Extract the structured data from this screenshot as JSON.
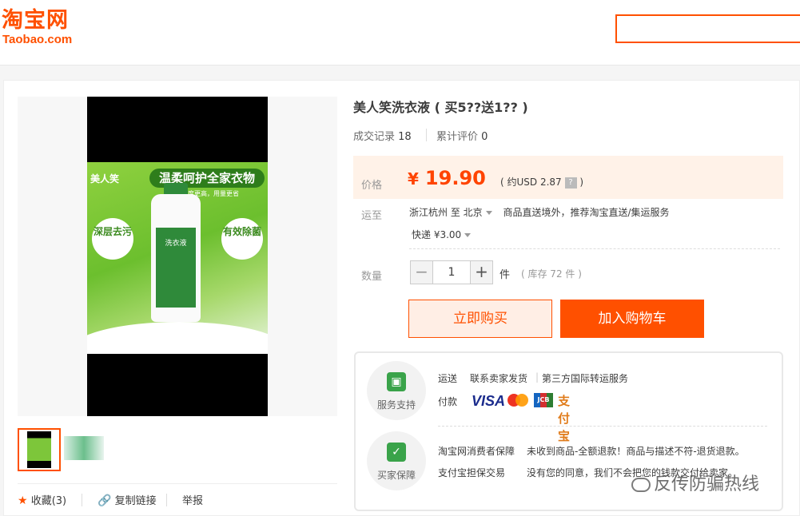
{
  "header": {
    "logo_cn": "淘宝网",
    "logo_en": "Taobao.com"
  },
  "gallery": {
    "image_texts": {
      "brand": "美人笑",
      "banner": "温柔呵护全家衣物",
      "sub": "浓度更高，用量更省",
      "bubble_left": "深层去污",
      "bubble_right": "有效除菌",
      "bottle_label": "洗衣液"
    },
    "actions": [
      {
        "label": "收藏(3)",
        "icon": "star-icon"
      },
      {
        "label": "复制链接",
        "icon": "link-icon"
      },
      {
        "label": "举报"
      }
    ]
  },
  "product": {
    "title": "美人笑洗衣液 ( 买5??送1?? )",
    "sales_label": "成交记录",
    "sales_count": "18",
    "reviews_label": "累计评价",
    "reviews_count": "0",
    "price_label": "价格",
    "currency_symbol": "¥",
    "price": "19.90",
    "usd_prefix": "( 约USD 2.87",
    "usd_help": "?",
    "usd_suffix": ")",
    "shipping_label": "运至",
    "ship_from": "浙江杭州 至",
    "ship_to": "北京",
    "ship_note": "商品直送境外，推荐淘宝直送/集运服务",
    "express": "快递 ¥3.00",
    "quantity_label": "数量",
    "quantity": "1",
    "minus": "−",
    "plus": "+",
    "unit": "件",
    "stock": "( 库存 72 件 )",
    "buy_now": "立即购买",
    "add_to_cart": "加入购物车"
  },
  "service": {
    "support_label": "服务支持",
    "guarantee_label": "买家保障",
    "shipping": "运送",
    "shipping_detail1": "联系卖家发货",
    "shipping_detail2": "第三方国际转运服务",
    "payment": "付款",
    "payment_methods": [
      "VISA",
      "MasterCard",
      "JCB",
      "支付宝"
    ],
    "protect_label": "淘宝网消费者保障",
    "protect_text": "未收到商品-全额退款！商品与描述不符-退货退款。",
    "alipay_label": "支付宝担保交易",
    "alipay_text": "没有您的同意，我们不会把您的钱款交付给卖家。"
  },
  "watermark": "反传防骗热线",
  "colors": {
    "brand": "#ff5000",
    "price": "#ff4400",
    "price_bg": "#fff2e8"
  }
}
